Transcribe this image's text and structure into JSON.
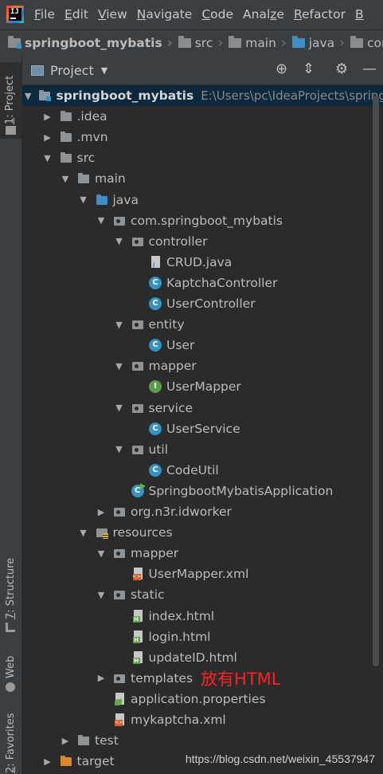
{
  "menubar": {
    "items": [
      {
        "label": "File",
        "u": "F",
        "rest": "ile"
      },
      {
        "label": "Edit",
        "u": "E",
        "rest": "dit"
      },
      {
        "label": "View",
        "u": "V",
        "rest": "iew"
      },
      {
        "label": "Navigate",
        "u": "N",
        "rest": "avigate"
      },
      {
        "label": "Code",
        "u": "C",
        "rest": "ode"
      },
      {
        "label": "Analyze",
        "u": "z",
        "pre": "Anal",
        "rest": "e"
      },
      {
        "label": "Refactor",
        "u": "R",
        "rest": "efactor"
      },
      {
        "label": "B",
        "u": "B",
        "rest": ""
      }
    ]
  },
  "breadcrumb": [
    "springboot_mybatis",
    "src",
    "main",
    "java",
    "com"
  ],
  "sidebar": {
    "project_num": "1",
    "project_label": ": Project",
    "structure_num": "7",
    "structure_label": ": Structure",
    "web_label": "Web",
    "favorites_num": "2",
    "favorites_label": ": Favorites"
  },
  "project_panel": {
    "title": "Project"
  },
  "tree": [
    {
      "label": "springboot_mybatis",
      "hint": "E:\\Users\\pc\\IdeaProjects\\springboot_",
      "depth": 0,
      "arrow": "open",
      "icon": "module",
      "selected": true,
      "bold": true
    },
    {
      "label": ".idea",
      "depth": 1,
      "arrow": "closed",
      "icon": "folder"
    },
    {
      "label": ".mvn",
      "depth": 1,
      "arrow": "closed",
      "icon": "folder"
    },
    {
      "label": "src",
      "depth": 1,
      "arrow": "open",
      "icon": "folder"
    },
    {
      "label": "main",
      "depth": 2,
      "arrow": "open",
      "icon": "folder"
    },
    {
      "label": "java",
      "depth": 3,
      "arrow": "open",
      "icon": "folder-blue"
    },
    {
      "label": "com.springboot_mybatis",
      "depth": 4,
      "arrow": "open",
      "icon": "package"
    },
    {
      "label": "controller",
      "depth": 5,
      "arrow": "open",
      "icon": "package"
    },
    {
      "label": "CRUD.java",
      "depth": 6,
      "arrow": "none",
      "icon": "java"
    },
    {
      "label": "KaptchaController",
      "depth": 6,
      "arrow": "none",
      "icon": "class"
    },
    {
      "label": "UserController",
      "depth": 6,
      "arrow": "none",
      "icon": "class"
    },
    {
      "label": "entity",
      "depth": 5,
      "arrow": "open",
      "icon": "package"
    },
    {
      "label": "User",
      "depth": 6,
      "arrow": "none",
      "icon": "class"
    },
    {
      "label": "mapper",
      "depth": 5,
      "arrow": "open",
      "icon": "package"
    },
    {
      "label": "UserMapper",
      "depth": 6,
      "arrow": "none",
      "icon": "interface"
    },
    {
      "label": "service",
      "depth": 5,
      "arrow": "open",
      "icon": "package"
    },
    {
      "label": "UserService",
      "depth": 6,
      "arrow": "none",
      "icon": "class"
    },
    {
      "label": "util",
      "depth": 5,
      "arrow": "open",
      "icon": "package"
    },
    {
      "label": "CodeUtil",
      "depth": 6,
      "arrow": "none",
      "icon": "class"
    },
    {
      "label": "SpringbootMybatisApplication",
      "depth": 5,
      "arrow": "none",
      "icon": "app"
    },
    {
      "label": "org.n3r.idworker",
      "depth": 4,
      "arrow": "closed",
      "icon": "package"
    },
    {
      "label": "resources",
      "depth": 3,
      "arrow": "open",
      "icon": "resources"
    },
    {
      "label": "mapper",
      "depth": 4,
      "arrow": "open",
      "icon": "package"
    },
    {
      "label": "UserMapper.xml",
      "depth": 5,
      "arrow": "none",
      "icon": "xml"
    },
    {
      "label": "static",
      "depth": 4,
      "arrow": "open",
      "icon": "package"
    },
    {
      "label": "index.html",
      "depth": 5,
      "arrow": "none",
      "icon": "html"
    },
    {
      "label": "login.html",
      "depth": 5,
      "arrow": "none",
      "icon": "html"
    },
    {
      "label": "updateID.html",
      "depth": 5,
      "arrow": "none",
      "icon": "html"
    },
    {
      "label": "templates",
      "depth": 4,
      "arrow": "closed",
      "icon": "package",
      "annotation": "放有HTML"
    },
    {
      "label": "application.properties",
      "depth": 4,
      "arrow": "none",
      "icon": "props"
    },
    {
      "label": "mykaptcha.xml",
      "depth": 4,
      "arrow": "none",
      "icon": "xml"
    },
    {
      "label": "test",
      "depth": 2,
      "arrow": "closed",
      "icon": "folder"
    },
    {
      "label": "target",
      "depth": 1,
      "arrow": "closed",
      "icon": "folder-orange"
    }
  ],
  "watermark": "https://blog.csdn.net/weixin_45537947",
  "colors": {
    "background": "#2b2b2b",
    "chrome": "#3c3f41",
    "selection": "#0d293e",
    "annotation": "#ff2020",
    "class_icon": "#3592c4",
    "interface_icon": "#5b9e4a"
  }
}
